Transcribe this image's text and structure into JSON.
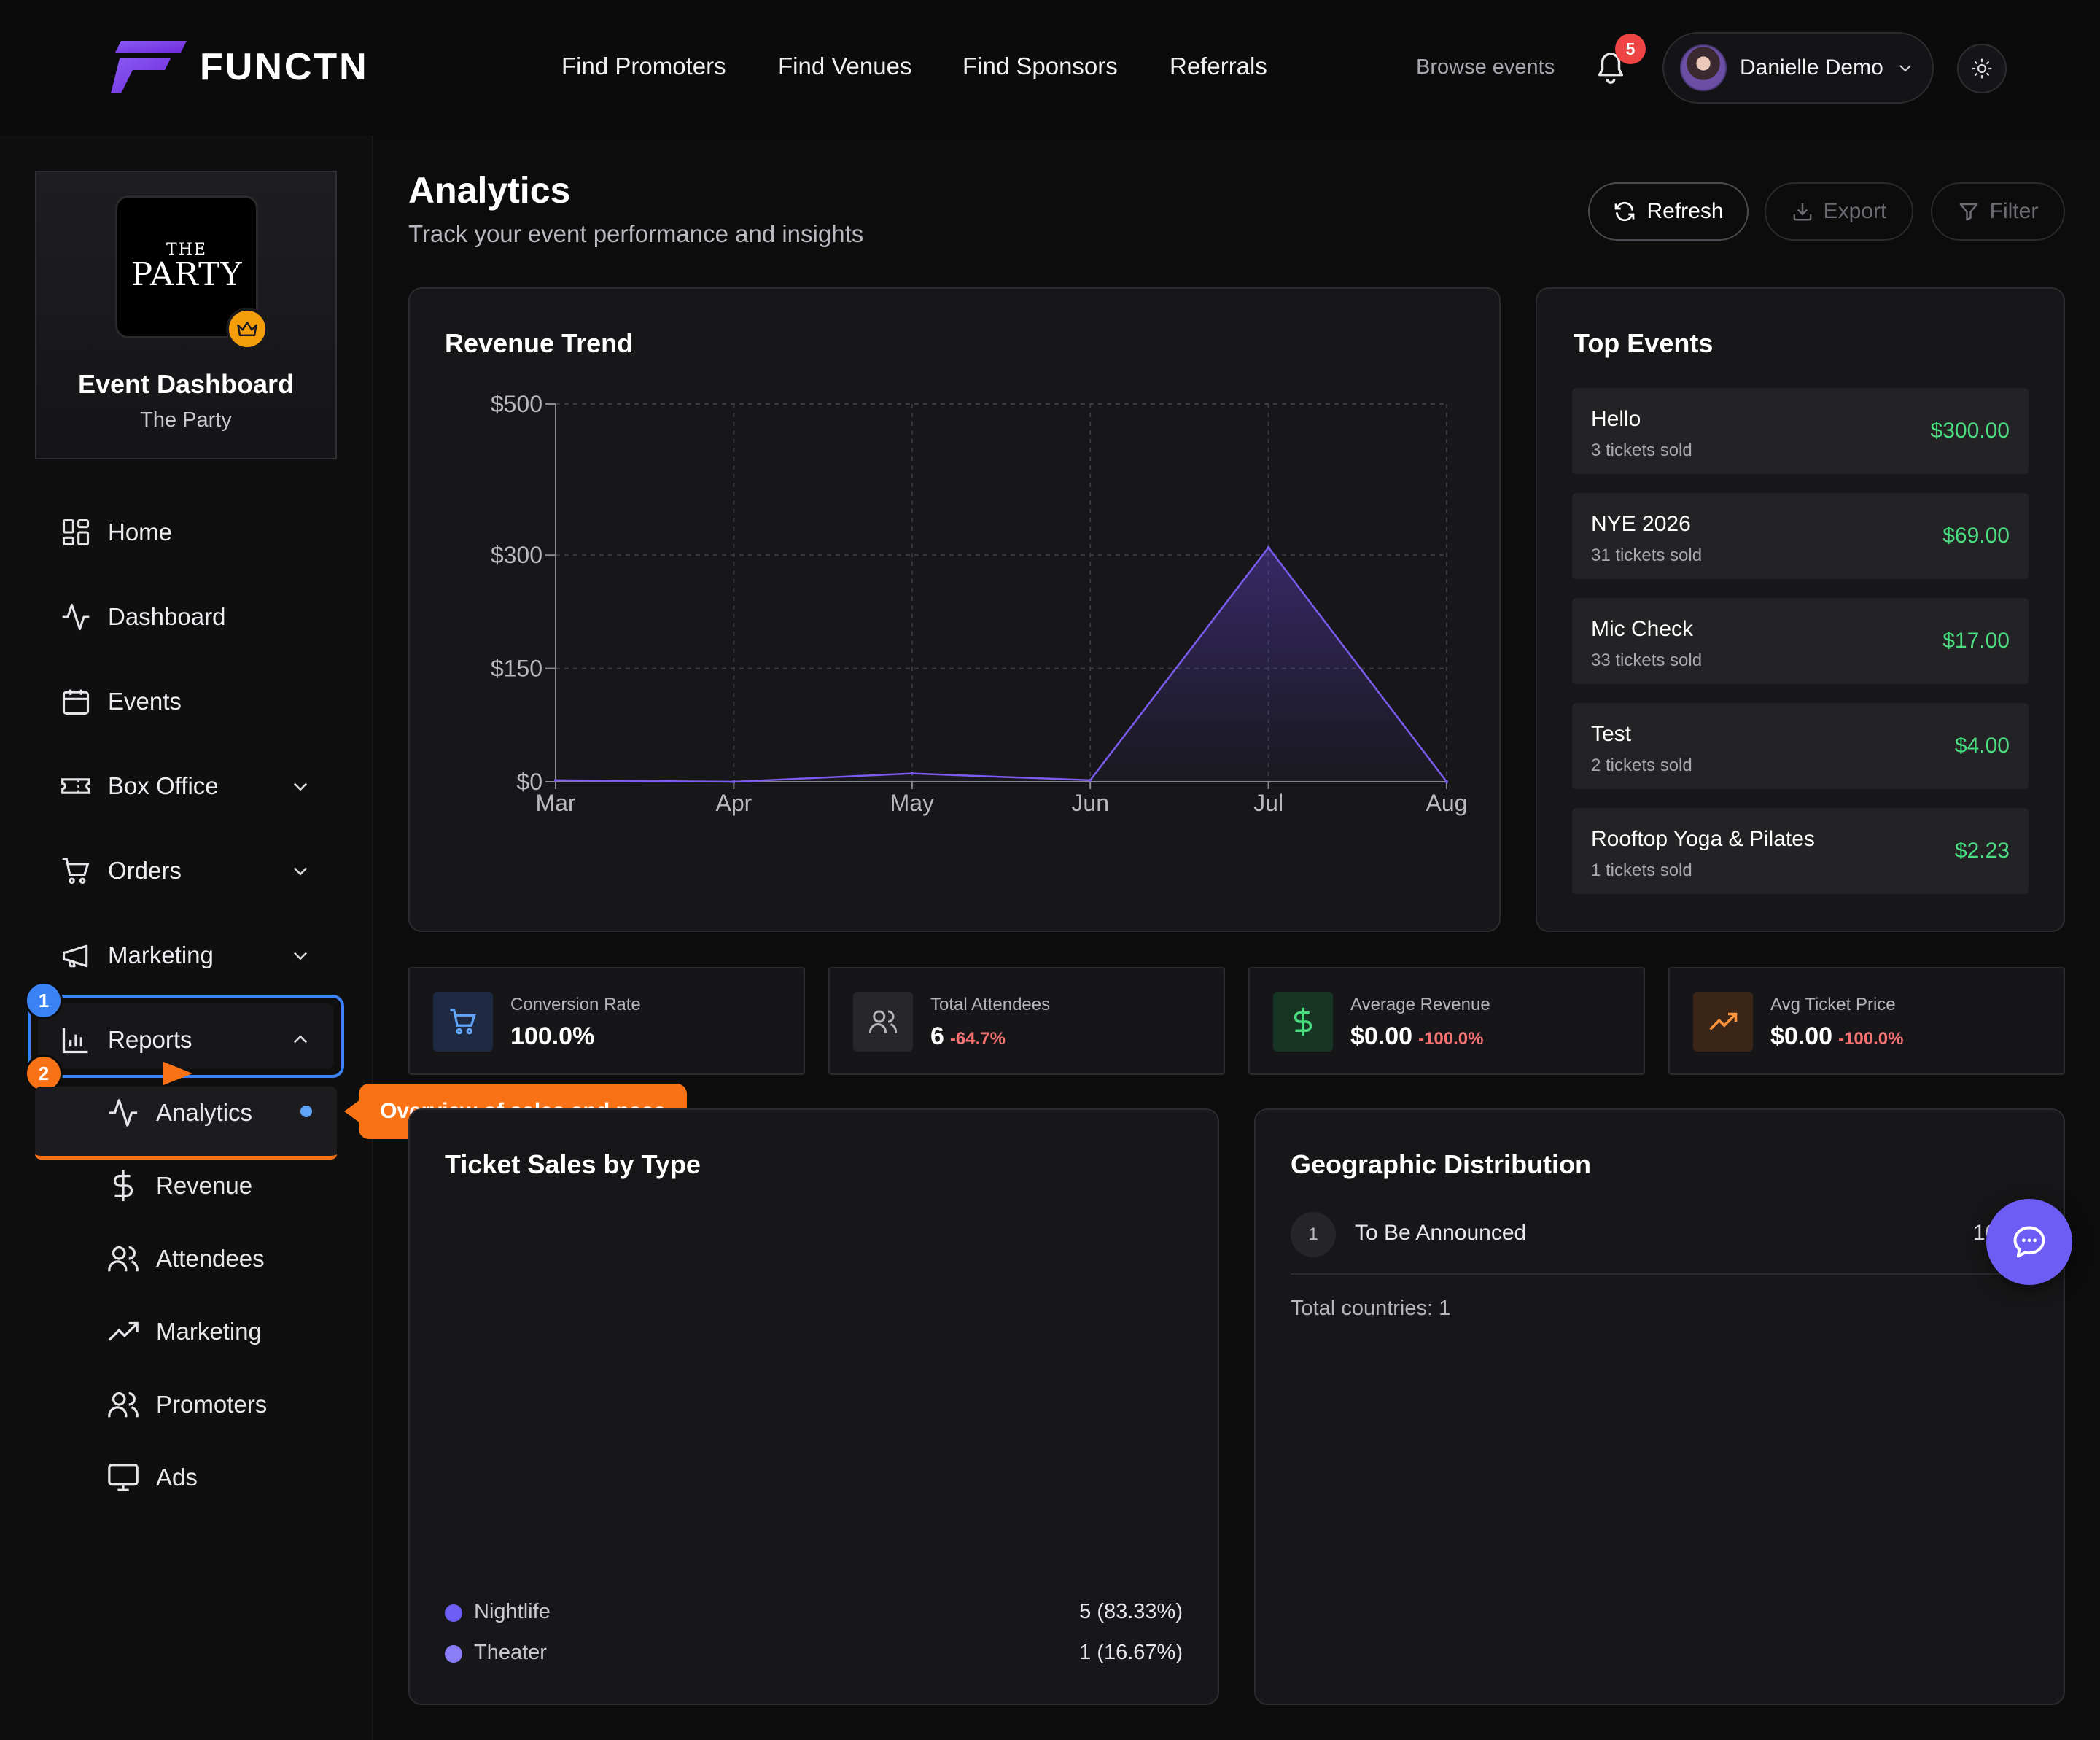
{
  "brand": {
    "name": "FUNCTN"
  },
  "nav": {
    "links": [
      "Find Promoters",
      "Find Venues",
      "Find Sponsors",
      "Referrals"
    ],
    "browse": "Browse events",
    "notifications": "5",
    "user": "Danielle Demo"
  },
  "sidebar": {
    "event_logo_top": "THE",
    "event_logo_main": "PARTY",
    "card_title": "Event Dashboard",
    "card_subtitle": "The Party",
    "items": [
      "Home",
      "Dashboard",
      "Events",
      "Box Office",
      "Orders",
      "Marketing",
      "Reports"
    ],
    "subitems": [
      "Analytics",
      "Revenue",
      "Attendees",
      "Marketing",
      "Promoters",
      "Ads"
    ],
    "steps": [
      "1",
      "2"
    ],
    "tooltip": "Overview of sales and pace"
  },
  "header": {
    "title": "Analytics",
    "subtitle": "Track your event performance and insights",
    "refresh": "Refresh",
    "export": "Export",
    "filter": "Filter"
  },
  "chart_data": {
    "type": "area",
    "title": "Revenue Trend",
    "categories": [
      "Mar",
      "Apr",
      "May",
      "Jun",
      "Jul",
      "Aug"
    ],
    "values": [
      2,
      0,
      11,
      2,
      310,
      0
    ],
    "yticks": [
      "$500",
      "$300",
      "$150",
      "$0"
    ],
    "ylim": [
      0,
      500
    ],
    "grid": true,
    "color": "#7c5cf0"
  },
  "top_events": {
    "title": "Top Events",
    "items": [
      {
        "name": "Hello",
        "sold": "3 tickets sold",
        "amount": "$300.00"
      },
      {
        "name": "NYE 2026",
        "sold": "31 tickets sold",
        "amount": "$69.00"
      },
      {
        "name": "Mic Check",
        "sold": "33 tickets sold",
        "amount": "$17.00"
      },
      {
        "name": "Test",
        "sold": "2 tickets sold",
        "amount": "$4.00"
      },
      {
        "name": "Rooftop Yoga & Pilates",
        "sold": "1 tickets sold",
        "amount": "$2.23"
      }
    ]
  },
  "stats": [
    {
      "label": "Conversion Rate",
      "value": "100.0%",
      "change": "",
      "icon": "cart-icon"
    },
    {
      "label": "Total Attendees",
      "value": "6",
      "change": "-64.7%",
      "icon": "users-icon"
    },
    {
      "label": "Average Revenue",
      "value": "$0.00",
      "change": "-100.0%",
      "icon": "dollar-icon"
    },
    {
      "label": "Avg Ticket Price",
      "value": "$0.00",
      "change": "-100.0%",
      "icon": "trending-up-icon"
    }
  ],
  "ticket_sales": {
    "title": "Ticket Sales by Type",
    "items": [
      {
        "name": "Nightlife",
        "value": "5 (83.33%)",
        "color": "#6d5df5"
      },
      {
        "name": "Theater",
        "value": "1 (16.67%)",
        "color": "#8b7cf8"
      }
    ]
  },
  "geo": {
    "title": "Geographic Distribution",
    "rank": "1",
    "location": "To Be Announced",
    "value": "10",
    "total": "Total countries: 1"
  }
}
